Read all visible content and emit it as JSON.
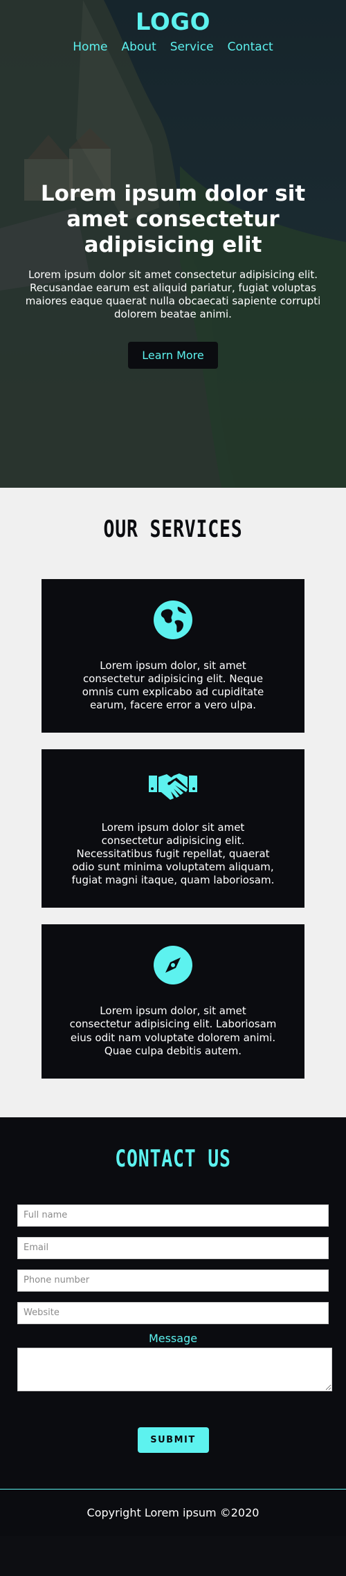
{
  "header": {
    "logo": "LOGO",
    "nav": [
      "Home",
      "About",
      "Service",
      "Contact"
    ]
  },
  "hero": {
    "title": "Lorem ipsum dolor sit amet consectetur adipisicing elit",
    "text": "Lorem ipsum dolor sit amet consectetur adipisicing elit. Recusandae earum est aliquid pariatur, fugiat voluptas maiores eaque quaerat nulla obcaecati sapiente corrupti dolorem beatae animi.",
    "button": "Learn More"
  },
  "services": {
    "title": "OUR SERVICES",
    "cards": [
      {
        "icon": "globe-icon",
        "text": "Lorem ipsum dolor, sit amet consectetur adipisicing elit. Neque omnis cum explicabo ad cupiditate earum, facere error a vero ulpa."
      },
      {
        "icon": "handshake-icon",
        "text": "Lorem ipsum dolor sit amet consectetur adipisicing elit. Necessitatibus fugit repellat, quaerat odio sunt minima voluptatem aliquam, fugiat magni itaque, quam laboriosam."
      },
      {
        "icon": "compass-icon",
        "text": "Lorem ipsum dolor, sit amet consectetur adipisicing elit. Laboriosam eius odit nam voluptate dolorem animi. Quae culpa debitis autem."
      }
    ]
  },
  "contact": {
    "title": "CONTACT US",
    "placeholders": {
      "name": "Full name",
      "email": "Email",
      "phone": "Phone number",
      "website": "Website"
    },
    "message_label": "Message",
    "submit": "SUBMIT"
  },
  "footer": {
    "copyright": "Copyright Lorem ipsum ©2020"
  },
  "colors": {
    "accent": "#5df2ef",
    "dark": "#0b0c10",
    "light_section": "#f0f0f0"
  }
}
